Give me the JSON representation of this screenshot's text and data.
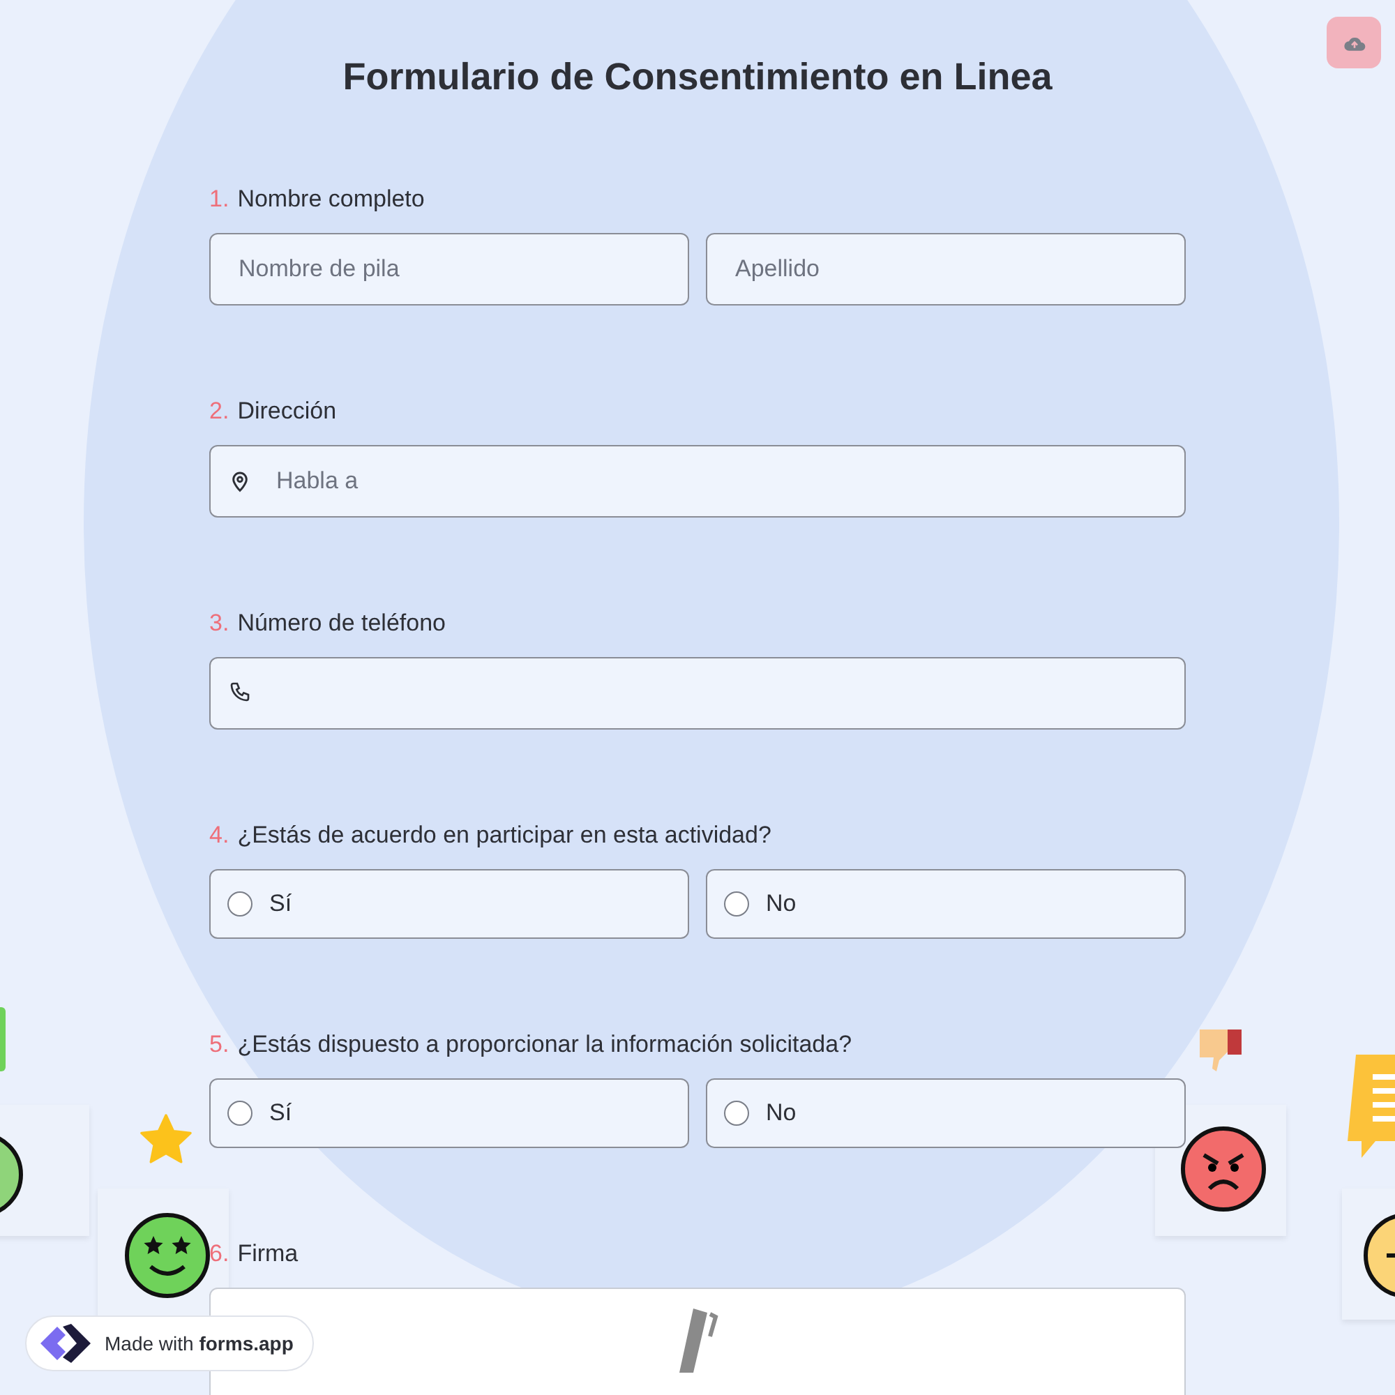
{
  "title": "Formulario de Consentimiento en Linea",
  "questions": [
    {
      "kind": "name",
      "number": "1.",
      "label": "Nombre completo",
      "fields": [
        {
          "placeholder": "Nombre de pila"
        },
        {
          "placeholder": "Apellido"
        }
      ]
    },
    {
      "kind": "address",
      "number": "2.",
      "label": "Dirección",
      "placeholder": "Habla a"
    },
    {
      "kind": "phone",
      "number": "3.",
      "label": "Número de teléfono"
    },
    {
      "kind": "choice",
      "number": "4.",
      "label": "¿Estás de acuerdo en participar en esta actividad?",
      "options": [
        {
          "label": "Sí",
          "selected": false
        },
        {
          "label": "No",
          "selected": false
        }
      ]
    },
    {
      "kind": "choice",
      "number": "5.",
      "label": "¿Estás dispuesto a proporcionar la información solicitada?",
      "options": [
        {
          "label": "Sí",
          "selected": false
        },
        {
          "label": "No",
          "selected": false
        }
      ]
    },
    {
      "kind": "signature",
      "number": "6.",
      "label": "Firma"
    }
  ],
  "badge": {
    "prefix": "Made with",
    "brand": "forms.app"
  }
}
